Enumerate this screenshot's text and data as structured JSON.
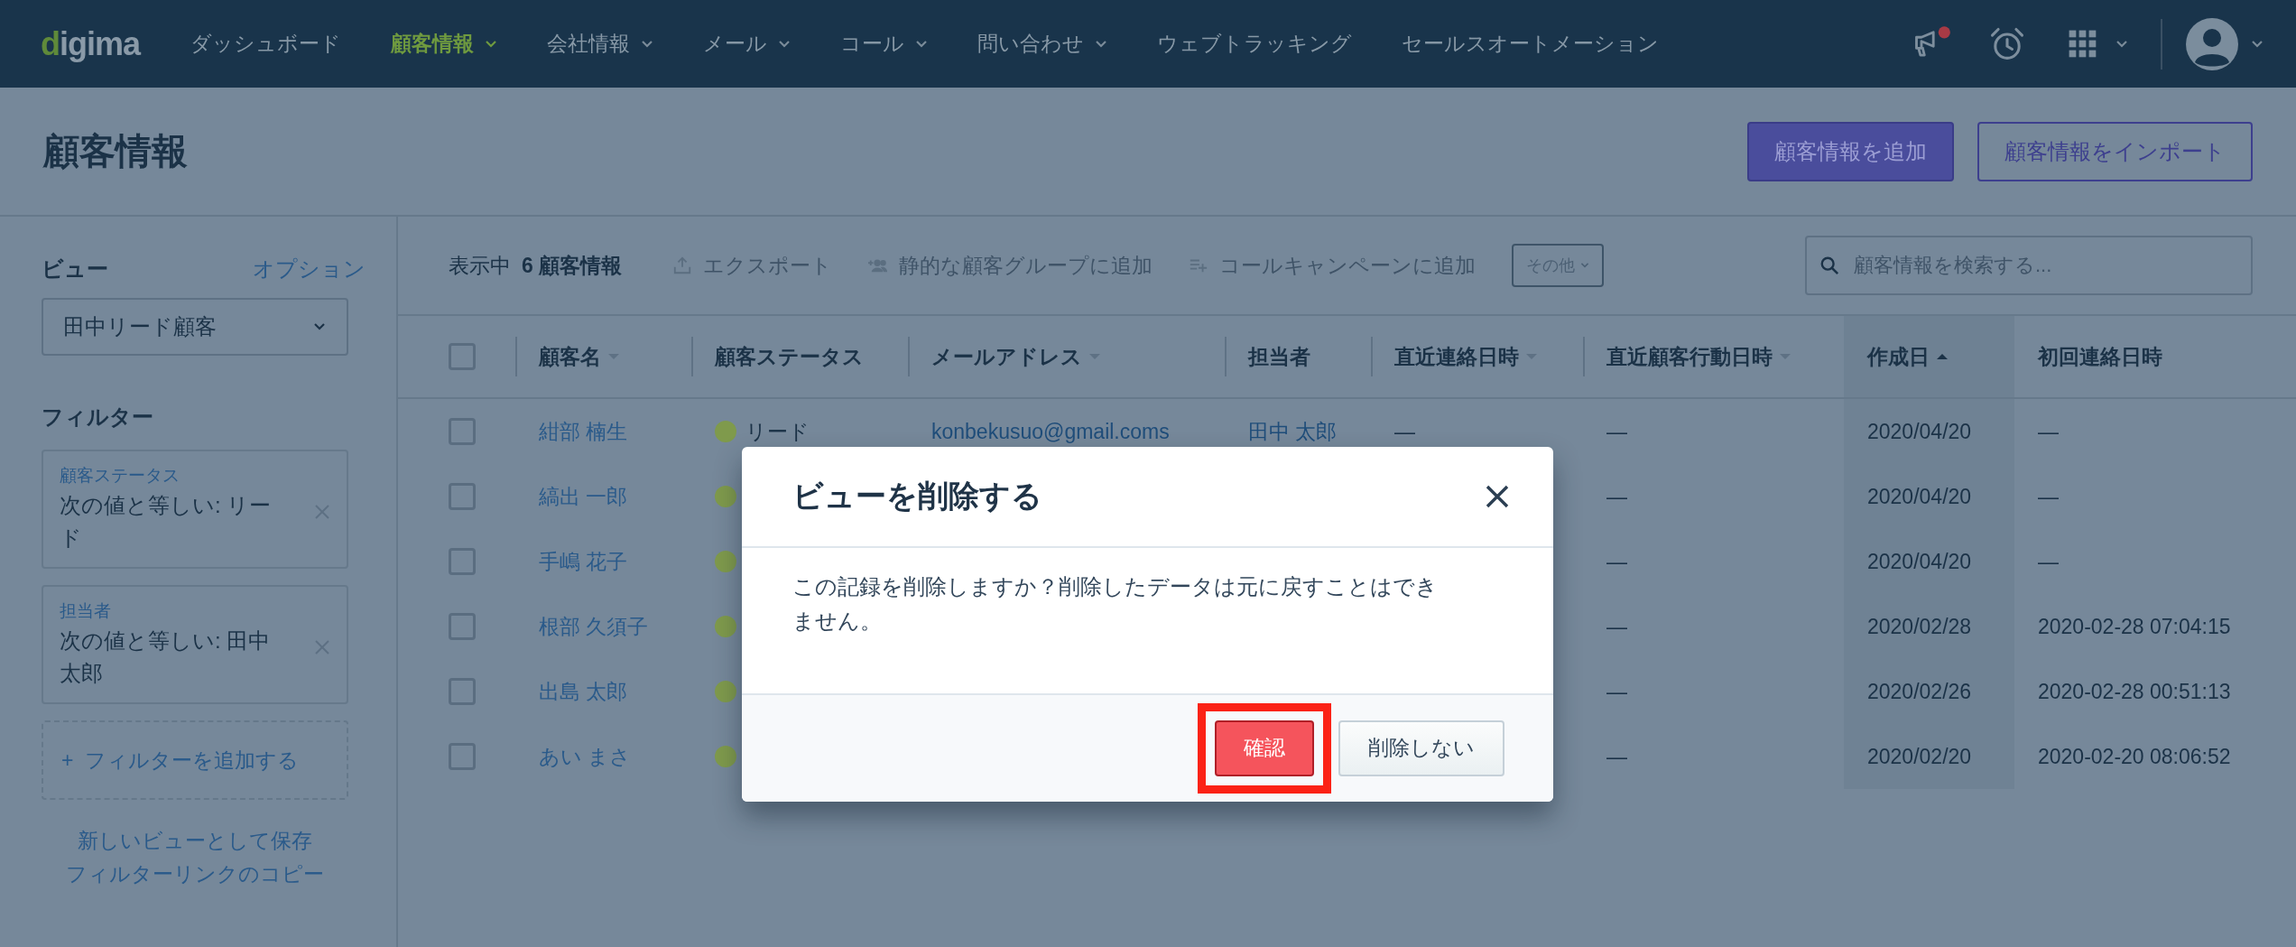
{
  "nav": {
    "logo": "digima",
    "items": [
      {
        "label": "ダッシュボード",
        "selected": false,
        "dropdown": false
      },
      {
        "label": "顧客情報",
        "selected": true,
        "dropdown": true
      },
      {
        "label": "会社情報",
        "selected": false,
        "dropdown": true
      },
      {
        "label": "メール",
        "selected": false,
        "dropdown": true
      },
      {
        "label": "コール",
        "selected": false,
        "dropdown": true
      },
      {
        "label": "問い合わせ",
        "selected": false,
        "dropdown": true
      },
      {
        "label": "ウェブトラッキング",
        "selected": false,
        "dropdown": false
      },
      {
        "label": "セールスオートメーション",
        "selected": false,
        "dropdown": false
      }
    ],
    "has_notification": true
  },
  "page": {
    "title": "顧客情報",
    "buttons": [
      {
        "label": "顧客情報を追加",
        "kind": "primary"
      },
      {
        "label": "顧客情報をインポート",
        "kind": "outline"
      }
    ]
  },
  "sidebar": {
    "view_label": "ビュー",
    "options_link": "オプション",
    "view_select": "田中リード顧客",
    "filters_label": "フィルター",
    "filters": [
      {
        "field": "顧客ステータス",
        "condition": "次の値と等しい: リード"
      },
      {
        "field": "担当者",
        "condition": "次の値と等しい: 田中太郎"
      }
    ],
    "add_filter": "+  フィルターを追加する",
    "links": [
      "新しいビューとして保存",
      "フィルターリンクのコピー"
    ]
  },
  "toolbar": {
    "showing_prefix": "表示中",
    "showing_count": "6 顧客情報",
    "actions": [
      {
        "label": "エクスポート",
        "kind": "export"
      },
      {
        "label": "静的な顧客グループに追加",
        "kind": "group"
      },
      {
        "label": "コールキャンペーンに追加",
        "kind": "call"
      }
    ],
    "more": "その他",
    "search": {
      "placeholder": "顧客情報を検索する..."
    }
  },
  "table": {
    "select_all": {
      "checked": false
    },
    "columns": [
      {
        "label": "顧客名",
        "sortable": true,
        "sorted": false
      },
      {
        "label": "顧客ステータス",
        "sortable": false
      },
      {
        "label": "メールアドレス",
        "sortable": true,
        "sorted": false
      },
      {
        "label": "担当者",
        "sortable": false
      },
      {
        "label": "直近連絡日時",
        "sortable": true,
        "sorted": false
      },
      {
        "label": "直近顧客行動日時",
        "sortable": true,
        "sorted": false
      },
      {
        "label": "作成日",
        "sortable": true,
        "sorted": true
      },
      {
        "label": "初回連絡日時",
        "sortable": false
      }
    ],
    "rows": [
      {
        "checked": false,
        "name": "紺部 楠生",
        "status": {
          "label": "リード",
          "color": "#7f9a4c"
        },
        "email": "konbekusuo@gmail.coms",
        "owner": "田中 太郎",
        "last_contact": "—",
        "last_action": "—",
        "created": "2020/04/20",
        "first_contact": "—"
      },
      {
        "checked": false,
        "name": "縞出 一郎",
        "status": {
          "color": "#7f9a4c"
        },
        "last_action": "—",
        "created": "2020/04/20",
        "first_contact": "—"
      },
      {
        "checked": false,
        "name": "手嶋 花子",
        "status": {
          "color": "#7f9a4c"
        },
        "last_action": "—",
        "created": "2020/04/20",
        "first_contact": "—"
      },
      {
        "checked": false,
        "name": "根部 久須子",
        "status": {
          "color": "#7f9a4c"
        },
        "last_action": "—",
        "created": "2020/02/28",
        "first_contact": "2020-02-28 07:04:15"
      },
      {
        "checked": false,
        "name": "出島 太郎",
        "status": {
          "color": "#7f9a4c"
        },
        "last_action": "—",
        "created": "2020/02/26",
        "first_contact": "2020-02-28 00:51:13"
      },
      {
        "checked": false,
        "name": "あい まさ",
        "status": {
          "color": "#7f9a4c"
        },
        "last_action": "—",
        "created": "2020/02/20",
        "first_contact": "2020-02-20 08:06:52"
      }
    ]
  },
  "modal": {
    "title": "ビューを削除する",
    "message": "この記録を削除しますか？削除したデータは元に戻すことはできません。",
    "buttons": [
      {
        "label": "確認",
        "kind": "danger",
        "highlighted": true
      },
      {
        "label": "削除しない",
        "kind": "default",
        "highlighted": false
      }
    ]
  }
}
